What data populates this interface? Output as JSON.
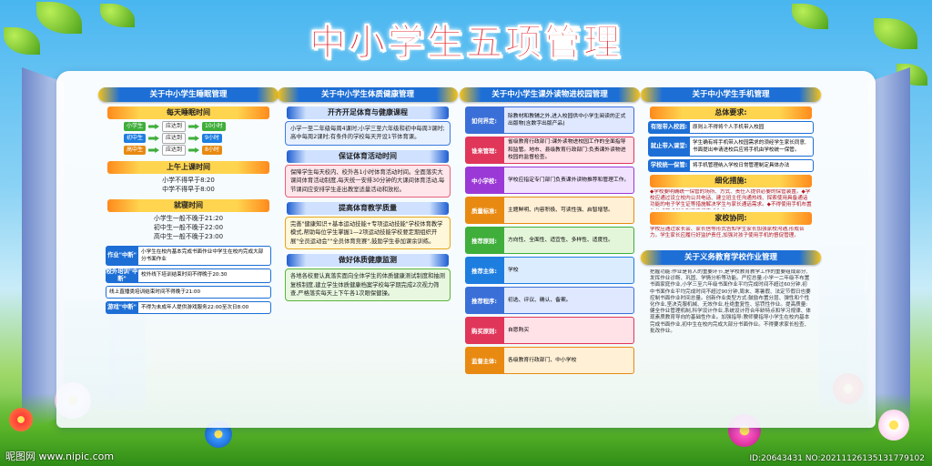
{
  "title": "中小学生五项管理",
  "columns": [
    {
      "header": "关于中小学生睡眠管理",
      "sleep_title": "每天睡眠时间",
      "sleep_rows": [
        {
          "group": "小学生",
          "verb": "应达到",
          "hours": "10小时",
          "color": "#3fae3a"
        },
        {
          "group": "初中生",
          "verb": "应达到",
          "hours": "9小时",
          "color": "#1e7ee0"
        },
        {
          "group": "高中生",
          "verb": "应达到",
          "hours": "8小时",
          "color": "#e88a12"
        }
      ],
      "morning_title": "上午上课时间",
      "morning_lines": [
        "小学不得早于8:20",
        "中学不得早于8:00"
      ],
      "bed_title": "就寝时间",
      "bed_lines": [
        "小学生一般不晚于21:20",
        "初中生一般不晚于22:00",
        "高中生一般不晚于23:00"
      ],
      "rules": [
        {
          "tag": "作业\"中断\"",
          "text": "小学生在校内基本完成书面作业中学生在校内完成大部分书面作业"
        },
        {
          "tag": "校外培训\"中断\"",
          "text": "校外线下培训结束时间不得晚于20:30"
        },
        {
          "tag": "",
          "text": "线上直播类培训结束时间不得晚于21:00"
        },
        {
          "tag": "游戏\"中断\"",
          "text": "不得为未成年人提供游戏服务22:00至次日8:00"
        }
      ]
    },
    {
      "header": "关于中小学生体质健康管理",
      "blocks": [
        {
          "title": "开齐开足体育与健康课程",
          "text": "小学一至二年级每周4课时;小学三至六年级和初中每周3课时; 高中每周2课时;有条件的学校每天开设1节体育课。"
        },
        {
          "title": "保证体育活动时间",
          "text": "保障学生每天校内、校外各1小时体育活动时间。全面落实大课间体育活动制度,每天统一安排30分钟的大课间体育活动,每节课间应安排学生走出教室适量活动和放松。"
        },
        {
          "title": "提高体育教学质量",
          "text": "完善\"健康知识+基本运动技能+专项运动技能\"学校体育教学模式,帮助每位学生掌握1—2项运动技能学校要定期组织开展\"全员运动会\"\"全员体育竞赛\",鼓励学生参加课余训练。"
        },
        {
          "title": "做好体质健康监测",
          "text": "各地各校要认真落实面向全体学生的体质健康测试制度和抽测复核制度,建立学生体质健康档案学校每学期完成2次视力筛查,严格落实每天上下午各1次眼保健操。"
        }
      ]
    },
    {
      "header": "关于中小学生课外读物进校园管理",
      "rows": [
        {
          "tag": "如何界定:",
          "text": "除教材和教辅之外,进入校园供中小学生阅读的正式出版物(含数字出版产品)",
          "color": "#3b6fd8",
          "bg": "#dfe8ff"
        },
        {
          "tag": "谁来管理:",
          "text": "省级教育行政部门:课外读物进校园工作的全面指导和监管。地市、县级教育行政部门:负责课外读物进校园的监督检查。",
          "color": "#e0365a",
          "bg": "#ffe1e8"
        },
        {
          "tag": "中小学校:",
          "text": "学校应指定专门部门负责课外读物推荐和管理工作。",
          "color": "#9b39d6",
          "bg": "#f1e2ff"
        },
        {
          "tag": "质量标准:",
          "text": "主题鲜明、内容积极、可读性强、启智增慧。",
          "color": "#e88a12",
          "bg": "#fff0d6"
        },
        {
          "tag": "推荐原则:",
          "text": "方向性、全面性、适宜性、多样性、适度性。",
          "color": "#3fae3a",
          "bg": "#e3f6da"
        },
        {
          "tag": "推荐主体:",
          "text": "学校",
          "color": "#1e7ee0",
          "bg": "#dcecff"
        },
        {
          "tag": "推荐程序:",
          "text": "初选、评议、确认、备案。",
          "color": "#3b6fd8",
          "bg": "#dfe8ff"
        },
        {
          "tag": "购买原则:",
          "text": "自愿购买",
          "color": "#e0365a",
          "bg": "#ffe1e8"
        },
        {
          "tag": "监督主体:",
          "text": "各级教育行政部门、中小学校",
          "color": "#e88a12",
          "bg": "#fff0d6"
        }
      ]
    },
    {
      "header": "关于中小学生手机管理",
      "overall_title": "总体要求:",
      "overall_rows": [
        {
          "tag": "有限带入校园:",
          "text": "原则上不得将个人手机带入校园"
        },
        {
          "tag": "就止带入课堂:",
          "text": "学生确有将手机带入校园需求的须经学生家长同意,书面提出申请进校后应将手机由学校统一保管。"
        },
        {
          "tag": "学校统一保管:",
          "text": "将手机管理纳入学校日常管理制定具体办法"
        }
      ],
      "detail_title": "细化措施:",
      "detail_text": "◆学校要明确统一保管的场所、方式、责任人提供必要的保管装置。◆学校应通过设立校内公共电话、建立班主任沟通热线、探索使用具备通话功能的电子学生证等措施解决学生与家长通话需求。◆不得使用手机布置作业或要求学生利用手机完成作业。",
      "home_title": "家校协同:",
      "home_text": "学校应通过家长会、家长信等形式告知学生家长加强家校沟通,形成合力。学生家长应履行好监护责任,加强对孩子使用手机的督促管理。",
      "hw_header": "关于义务教育学校作业管理",
      "hw_text": "把握功能:作业是育人的重要环节,是学校教育教学工作的重要组成部分,发挥作业诊断、巩固、学情分析等功能。严控总量:小学一二年级不布置书面家庭作业,小学三至六年级书面作业平均完成时间不超过60分钟,初中书面作业平均完成时间不超过90分钟,周末、寒暑假、法定节假日也要控制书面作业时间总量。创新作业类型方式:鼓励布置分层、弹性和个性化作业,坚决克服机械、无效作业,杜绝重复性、惩罚性作业。提高质量:健全作业管理机制,科学设计作业,系统设计符合年龄特点和学习规律、体现素质教育导向的基础性作业。加强指导:教师要指导小学生在校内基本完成书面作业,初中生在校内完成大部分书面作业。不得要求家长检查、批改作业。"
    }
  ],
  "watermark": {
    "left": "昵图网 www.nipic.com",
    "right": "ID:20643431 NO:20211126135131779102"
  }
}
